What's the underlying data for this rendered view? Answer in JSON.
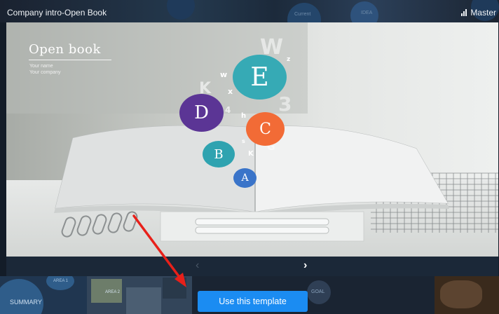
{
  "header": {
    "title": "Company intro-Open Book",
    "master_label": "Master"
  },
  "background_gallery": {
    "top_labels": [
      "Current",
      "IDEA"
    ],
    "bottom_labels": [
      "AREA 1",
      "AREA 2",
      "SUMMARY",
      "GOAL"
    ]
  },
  "slide": {
    "title": "Open book",
    "subtitle_lines": [
      "Your name",
      "Your company"
    ],
    "bubbles": [
      {
        "letter": "E",
        "color": "#36aab5"
      },
      {
        "letter": "D",
        "color": "#5b3595"
      },
      {
        "letter": "C",
        "color": "#f26b36"
      },
      {
        "letter": "B",
        "color": "#2fa3b0"
      },
      {
        "letter": "A",
        "color": "#3a74c9"
      }
    ],
    "floating_letters": [
      "W",
      "K",
      "3",
      "w",
      "x",
      "h",
      "z",
      "4",
      "G",
      "K",
      "s"
    ]
  },
  "nav": {
    "prev_symbol": "‹",
    "next_symbol": "›"
  },
  "cta": {
    "label": "Use this template",
    "color": "#1b8cf2"
  },
  "annotation": {
    "arrow_color": "#e8201a"
  }
}
